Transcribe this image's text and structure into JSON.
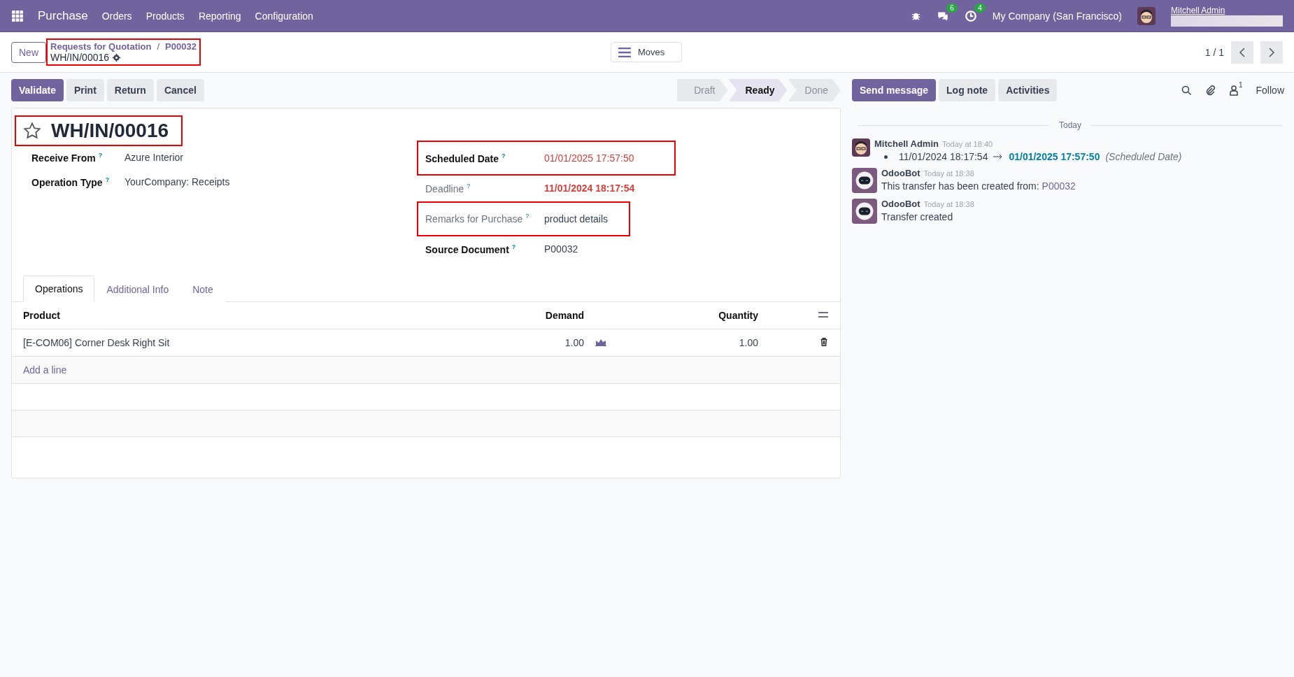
{
  "navbar": {
    "app": "Purchase",
    "menus": [
      "Orders",
      "Products",
      "Reporting",
      "Configuration"
    ],
    "chat_count": "6",
    "activity_count": "4",
    "company": "My Company (San Francisco)",
    "user": "Mitchell Admin"
  },
  "control_panel": {
    "new_button": "New",
    "breadcrumb": {
      "highlighted": true,
      "separator": "/",
      "parents": [
        "Requests for Quotation",
        "P00032"
      ],
      "current": "WH/IN/00016"
    },
    "moves_button": "Moves",
    "pager": "1 / 1"
  },
  "actions": [
    "Validate",
    "Print",
    "Return",
    "Cancel"
  ],
  "statusbar": [
    {
      "label": "Draft",
      "selected": false
    },
    {
      "label": "Ready",
      "selected": true
    },
    {
      "label": "Done",
      "selected": false
    }
  ],
  "chatter": {
    "buttons": [
      "Send message",
      "Log note",
      "Activities"
    ],
    "followers": "1",
    "follow": "Follow",
    "separator": "Today",
    "messages": [
      {
        "author": "Mitchell Admin",
        "kind": "user",
        "time": "Today at 18:40",
        "change": {
          "old": "11/01/2024 18:17:54",
          "new": "01/01/2025 17:57:50",
          "field": "(Scheduled Date)"
        }
      },
      {
        "author": "OdooBot",
        "kind": "bot",
        "time": "Today at 18:38",
        "body": "This transfer has been created from:",
        "link": "P00032"
      },
      {
        "author": "OdooBot",
        "kind": "bot",
        "time": "Today at 18:38",
        "body": "Transfer created"
      }
    ]
  },
  "form": {
    "title": "WH/IN/00016",
    "title_highlighted": true,
    "left_fields": [
      {
        "label": "Receive From",
        "help": "?",
        "value": "Azure Interior",
        "highlighted": false,
        "label_muted": false,
        "warning": false,
        "bold": false
      },
      {
        "label": "Operation Type",
        "help": "?",
        "value": "YourCompany: Receipts",
        "highlighted": false,
        "label_muted": false,
        "warning": false,
        "bold": false
      }
    ],
    "right_fields": [
      {
        "label": "Scheduled Date",
        "help": "?",
        "value": "01/01/2025 17:57:50",
        "highlighted": true,
        "label_muted": false,
        "warning": true,
        "bold": false
      },
      {
        "label": "Deadline",
        "help": "?",
        "value": "11/01/2024 18:17:54",
        "highlighted": false,
        "label_muted": true,
        "warning": true,
        "bold": true
      },
      {
        "label": "Remarks for Purchase",
        "help": "?",
        "value": "product details",
        "highlighted": true,
        "label_muted": true,
        "warning": false,
        "bold": false
      },
      {
        "label": "Source Document",
        "help": "?",
        "value": "P00032",
        "highlighted": false,
        "label_muted": false,
        "warning": false,
        "bold": false
      }
    ],
    "tabs": [
      {
        "label": "Operations",
        "selected": true
      },
      {
        "label": "Additional Info",
        "selected": false
      },
      {
        "label": "Note",
        "selected": false
      }
    ],
    "table": {
      "columns": [
        "Product",
        "Demand",
        "Quantity"
      ],
      "rows": [
        {
          "product": "[E-COM06] Corner Desk Right Sit",
          "demand": "1.00",
          "quantity": "1.00"
        }
      ],
      "add_line": "Add a line"
    }
  }
}
